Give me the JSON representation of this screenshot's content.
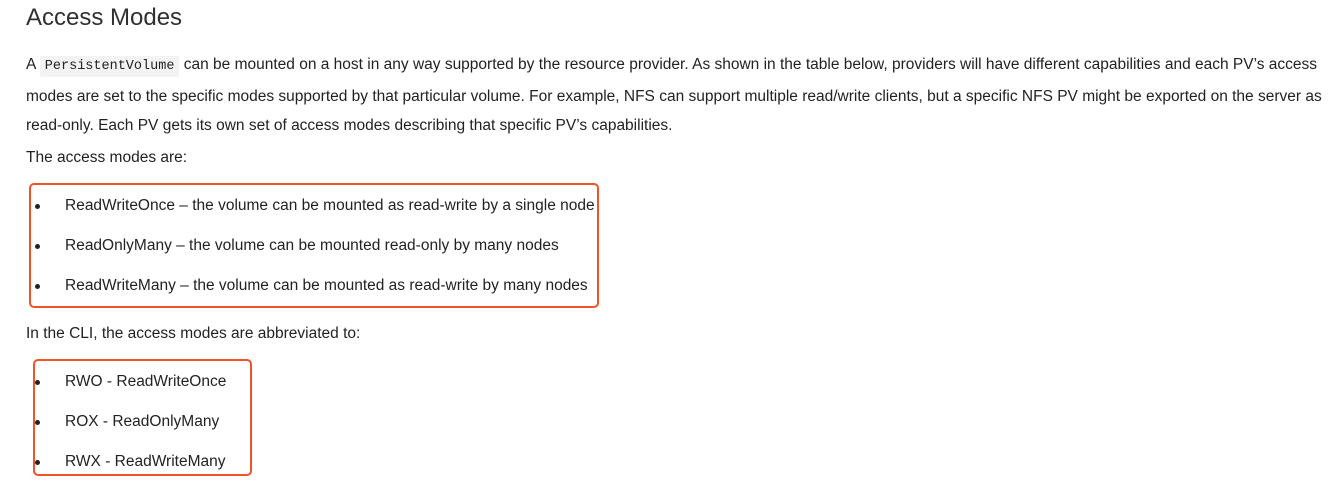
{
  "section": {
    "title": "Access Modes"
  },
  "intro": {
    "prefix": "A ",
    "code": "PersistentVolume",
    "text": " can be mounted on a host in any way supported by the resource provider. As shown in the table below, providers will have different capabilities and each PV’s access modes are set to the specific modes supported by that particular volume. For example, NFS can support multiple read/write clients, but a specific NFS PV might be exported on the server as read-only. Each PV gets its own set of access modes describing that specific PV’s capabilities."
  },
  "modes": {
    "lead": "The access modes are:",
    "items": [
      {
        "text": "ReadWriteOnce – the volume can be mounted as read-write by a single node"
      },
      {
        "text": "ReadOnlyMany – the volume can be mounted read-only by many nodes"
      },
      {
        "text": "ReadWriteMany – the volume can be mounted as read-write by many nodes"
      }
    ]
  },
  "abbreviations": {
    "lead": "In the CLI, the access modes are abbreviated to:",
    "items": [
      {
        "text": "RWO - ReadWriteOnce"
      },
      {
        "text": "ROX - ReadOnlyMany"
      },
      {
        "text": "RWX - ReadWriteMany"
      }
    ]
  },
  "colors": {
    "highlight_border": "#f0532a",
    "text": "#222222",
    "code_background": "#f3f3f3"
  }
}
